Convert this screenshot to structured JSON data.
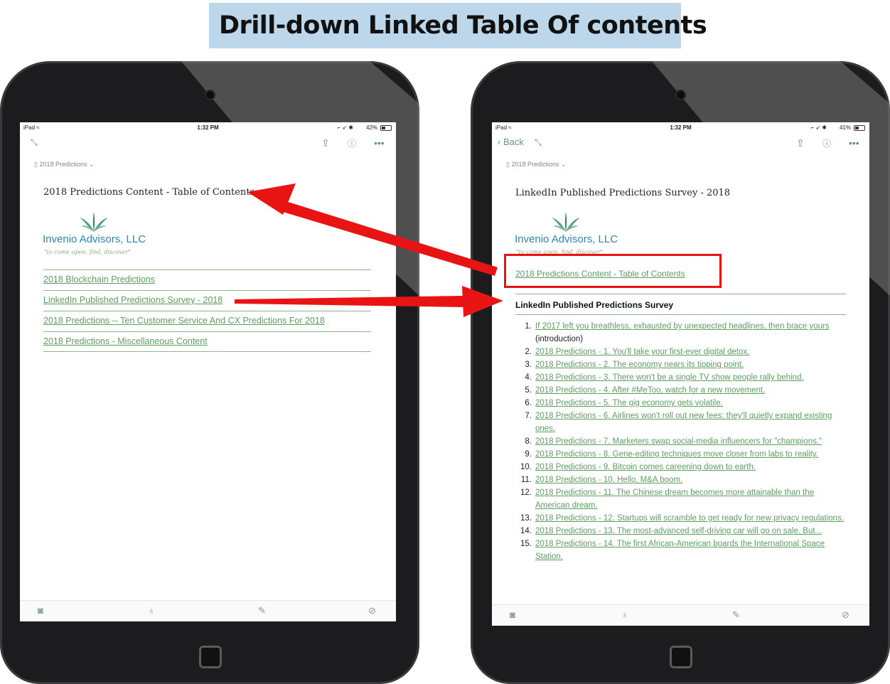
{
  "banner": {
    "title": "Drill-down Linked Table Of contents"
  },
  "left_screen": {
    "status": {
      "carrier": "iPad ≈",
      "time": "1:32 PM",
      "battery": "42%"
    },
    "notebook": "2018 Predictions",
    "title": "2018 Predictions Content - Table of Contents",
    "logo": {
      "name": "Invenio Advisors, LLC",
      "tagline": "\"to come upon, find, discover\""
    },
    "links": [
      "2018 Blockchain Predictions",
      "LinkedIn Published Predictions Survey - 2018",
      "2018 Predictions -- Ten Customer Service And CX Predictions For 2018",
      "2018 Predictions - Miscellaneous Content"
    ]
  },
  "right_screen": {
    "status": {
      "carrier": "iPad ≈",
      "time": "1:32 PM",
      "battery": "41%"
    },
    "back_label": "Back",
    "notebook": "2018 Predictions",
    "title": "LinkedIn Published Predictions Survey - 2018",
    "logo": {
      "name": "Invenio Advisors, LLC",
      "tagline": "\"to come upon, find, discover\""
    },
    "toc_link": "2018 Predictions Content - Table of Contents",
    "survey_heading": "LinkedIn Published Predictions Survey",
    "items": [
      {
        "num": "1.",
        "text": "If 2017 left you breathless, exhausted by unexpected headlines, then brace yours",
        "suffix": " (introduction)"
      },
      {
        "num": "2.",
        "text": "2018 Predictions - 1. You'll take your first-ever digital detox.",
        "suffix": ""
      },
      {
        "num": "3.",
        "text": "2018 Predictions - 2. The economy nears its tipping point.",
        "suffix": ""
      },
      {
        "num": "4.",
        "text": "2018 Predictions - 3. There won't be a single TV show people rally behind.",
        "suffix": ""
      },
      {
        "num": "5.",
        "text": "2018 Predictions - 4. After #MeToo, watch for a new movement.",
        "suffix": ""
      },
      {
        "num": "6.",
        "text": "2018 Predictions - 5. The gig economy gets volatile.",
        "suffix": ""
      },
      {
        "num": "7.",
        "text": "2018 Predictions - 6. Airlines won't roll out new fees; they'll quietly expand existing ones.",
        "suffix": ""
      },
      {
        "num": "8.",
        "text": "2018 Predictions - 7. Marketers swap social-media influencers for \"champions.\"",
        "suffix": ""
      },
      {
        "num": "9.",
        "text": "2018 Predictions - 8. Gene-editing techniques move closer from labs to reality.",
        "suffix": ""
      },
      {
        "num": "10.",
        "text": "2018 Predictions - 9. Bitcoin comes careening down to earth.",
        "suffix": ""
      },
      {
        "num": "11.",
        "text": "2018 Predictions - 10. Hello, M&A boom.",
        "suffix": ""
      },
      {
        "num": "12.",
        "text": "2018 Predictions - 11. The Chinese dream becomes more attainable than the American dream.",
        "suffix": ""
      },
      {
        "num": "13.",
        "text": "2018 Predictions - 12. Startups will scramble to get ready for new privacy regulations.",
        "suffix": ""
      },
      {
        "num": "14.",
        "text": "2018 Predictions - 13. The most-advanced self-driving car will go on sale. But...",
        "suffix": ""
      },
      {
        "num": "15.",
        "text": "2018 Predictions - 14. The first African-American boards the International Space Station.",
        "suffix": ""
      }
    ]
  },
  "colors": {
    "annotation_red": "#e11111",
    "link_green": "#5e9e62",
    "banner_blue": "#bcd6ea"
  }
}
